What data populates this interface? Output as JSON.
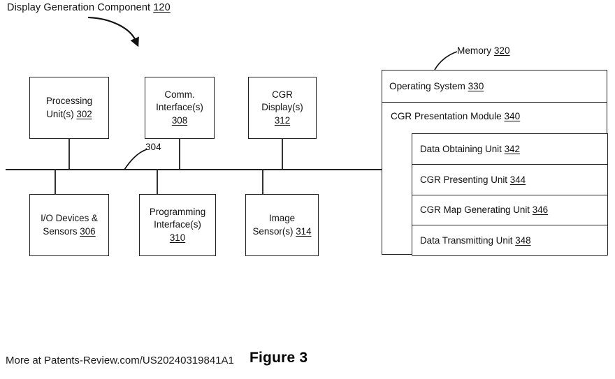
{
  "figure": {
    "title_text": "Display Generation Component",
    "title_ref": "120",
    "caption": "Figure 3",
    "watermark": "More at Patents-Review.com/US20240319841A1",
    "bus_label": "304",
    "memory_label_text": "Memory",
    "memory_label_ref": "320",
    "colors": {
      "line": "#222222",
      "text": "#111111",
      "background": "#ffffff"
    }
  },
  "components": {
    "processing_unit": {
      "line1": "Processing",
      "line2": "Unit(s)",
      "ref": "302"
    },
    "comm_interface": {
      "line1": "Comm.",
      "line2": "Interface(s)",
      "ref": "308"
    },
    "cgr_display": {
      "line1": "CGR",
      "line2": "Display(s)",
      "ref": "312"
    },
    "io_devices": {
      "line1": "I/O Devices &",
      "line2": "Sensors",
      "ref": "306"
    },
    "programming_interface": {
      "line1": "Programming",
      "line2": "Interface(s)",
      "ref": "310"
    },
    "image_sensor": {
      "line1": "Image",
      "line2": "Sensor(s)",
      "ref": "314"
    }
  },
  "memory": {
    "operating_system": {
      "label": "Operating System",
      "ref": "330"
    },
    "cgr_presentation_module": {
      "label": "CGR Presentation Module",
      "ref": "340"
    },
    "units": [
      {
        "label": "Data Obtaining Unit",
        "ref": "342"
      },
      {
        "label": "CGR Presenting Unit",
        "ref": "344"
      },
      {
        "label": "CGR Map Generating Unit",
        "ref": "346"
      },
      {
        "label": "Data Transmitting Unit",
        "ref": "348"
      }
    ]
  }
}
